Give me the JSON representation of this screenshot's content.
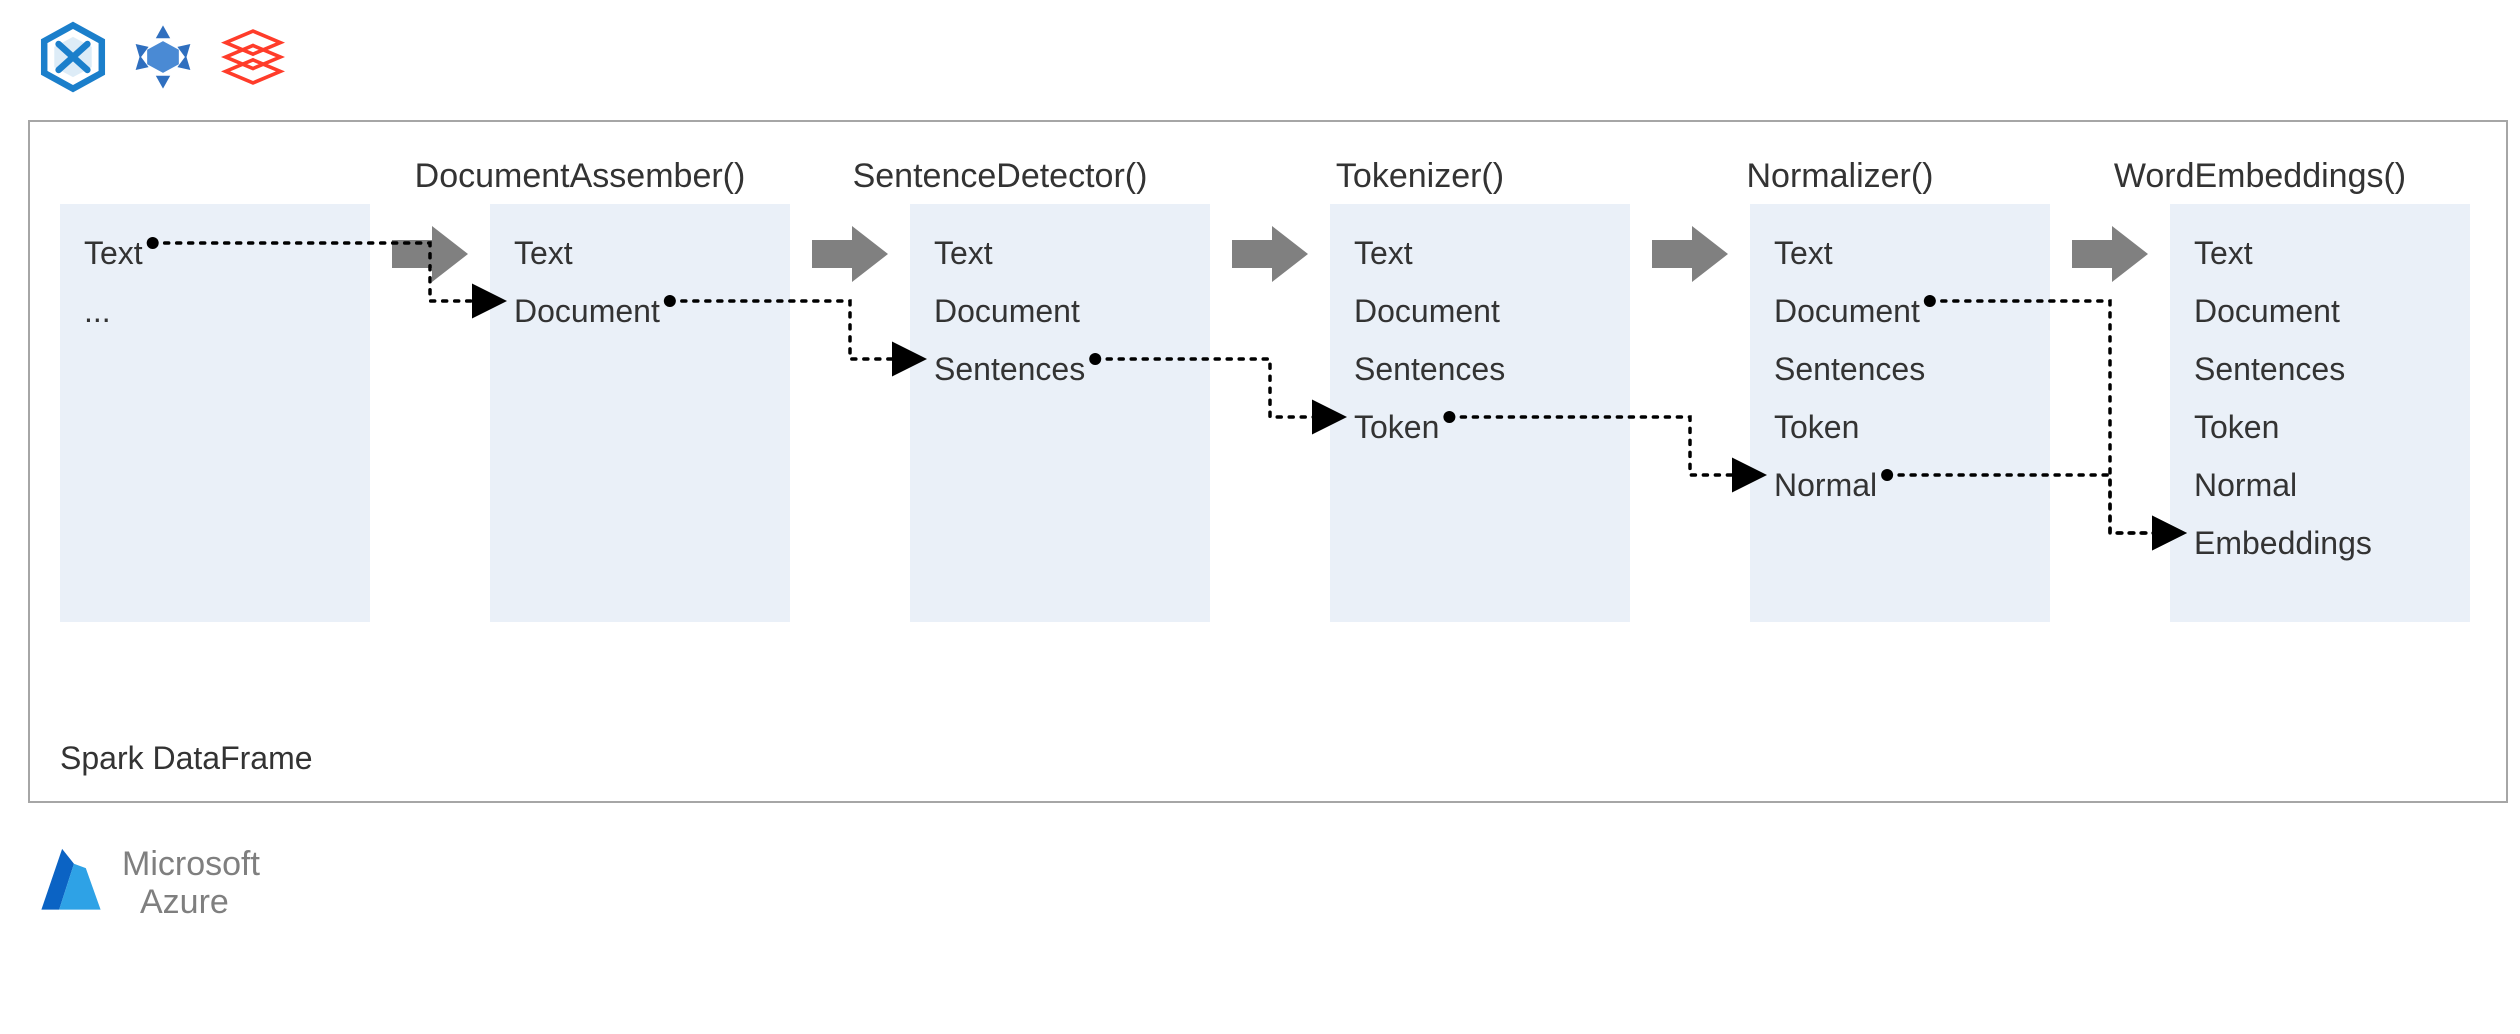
{
  "frame_caption": "Spark DataFrame",
  "footer": {
    "line1": "Microsoft",
    "line2": "Azure"
  },
  "colors": {
    "box_bg": "#eaf0f8",
    "frame_border": "#a6a6a6",
    "arrow_fill": "#808080",
    "synapse_blue": "#1b7fcb",
    "hdinsight_blue": "#2f6fbf",
    "databricks_red": "#ff3c2a",
    "azure_a": "#0078d4"
  },
  "stages": [
    {
      "label": "",
      "rows": [
        "Text",
        "..."
      ]
    },
    {
      "label": "DocumentAssember()",
      "rows": [
        "Text",
        "Document"
      ]
    },
    {
      "label": "SentenceDetector()",
      "rows": [
        "Text",
        "Document",
        "Sentences"
      ]
    },
    {
      "label": "Tokenizer()",
      "rows": [
        "Text",
        "Document",
        "Sentences",
        "Token"
      ]
    },
    {
      "label": "Normalizer()",
      "rows": [
        "Text",
        "Document",
        "Sentences",
        "Token",
        "Normal"
      ]
    },
    {
      "label": "WordEmbeddings()",
      "rows": [
        "Text",
        "Document",
        "Sentences",
        "Token",
        "Normal",
        "Embeddings"
      ]
    }
  ],
  "connectors": [
    {
      "from_stage": 0,
      "from_row": "Text",
      "to_stage": 1,
      "to_row": "Document"
    },
    {
      "from_stage": 1,
      "from_row": "Document",
      "to_stage": 2,
      "to_row": "Sentences"
    },
    {
      "from_stage": 2,
      "from_row": "Sentences",
      "to_stage": 3,
      "to_row": "Token"
    },
    {
      "from_stage": 3,
      "from_row": "Token",
      "to_stage": 4,
      "to_row": "Normal"
    },
    {
      "from_stage": 4,
      "from_row": "Normal",
      "to_stage": 5,
      "to_row": "Embeddings"
    },
    {
      "from_stage": 4,
      "from_row": "Document",
      "to_stage": 5,
      "to_row": "Embeddings"
    }
  ]
}
